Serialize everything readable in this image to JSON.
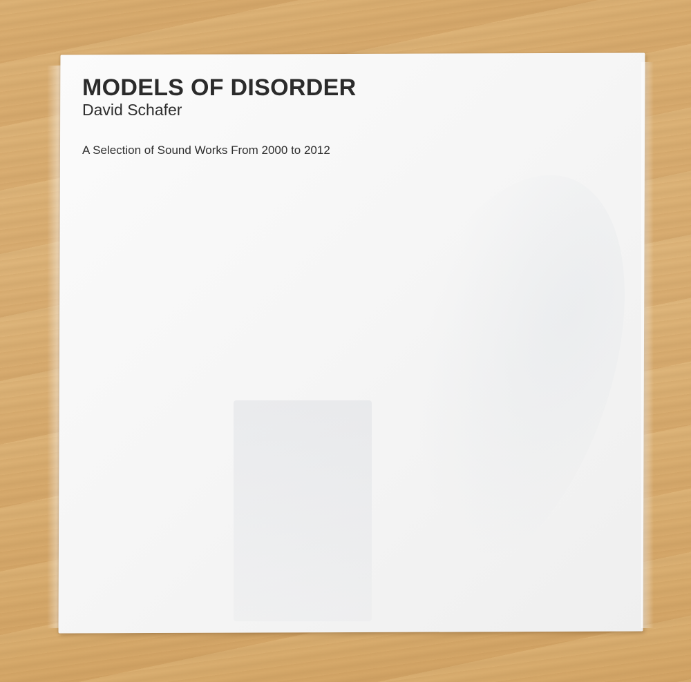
{
  "album": {
    "title": "MODELS OF DISORDER",
    "artist": "David Schafer",
    "subtitle": "A Selection of Sound Works From 2000 to 2012"
  },
  "colors": {
    "table": "#d9ad70",
    "sleeve": "#f7f7f7",
    "text": "#2b2b2b"
  }
}
